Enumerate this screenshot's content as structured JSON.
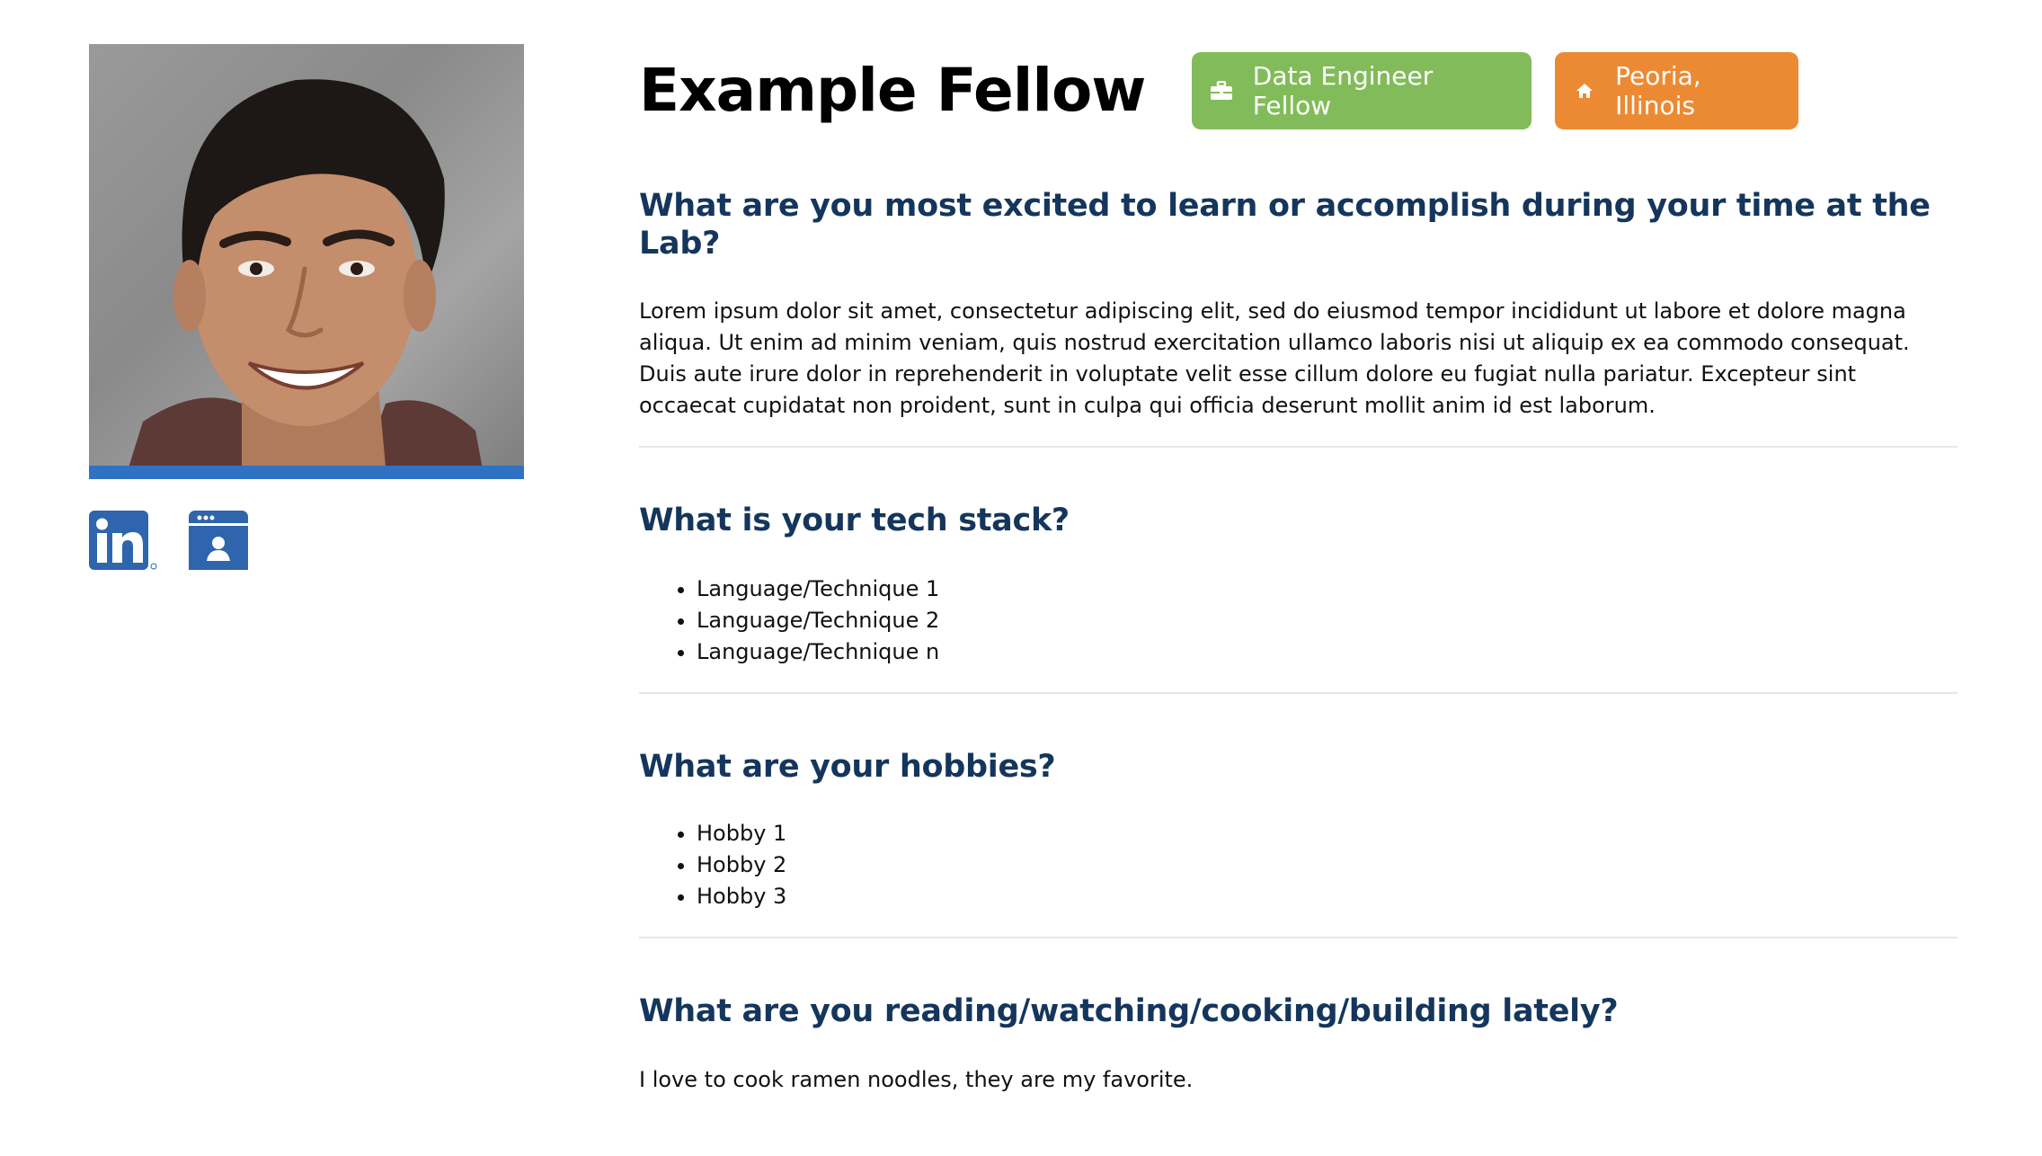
{
  "profile": {
    "name": "Example Fellow",
    "role": "Data Engineer Fellow",
    "location": "Peoria, Illinois",
    "role_icon": "briefcase-icon",
    "location_icon": "home-icon",
    "role_color": "#82bc5a",
    "location_color": "#ec8a33"
  },
  "social": {
    "linkedin_icon": "linkedin-icon",
    "portfolio_icon": "portfolio-icon",
    "icon_color": "#2f65ad"
  },
  "sections": {
    "excited": {
      "heading": "What are you most excited to learn or accomplish during your time at the Lab?",
      "body": "Lorem ipsum dolor sit amet, consectetur adipiscing elit, sed do eiusmod tempor incididunt ut labore et dolore magna aliqua. Ut enim ad minim veniam, quis nostrud exercitation ullamco laboris nisi ut aliquip ex ea commodo consequat. Duis aute irure dolor in reprehenderit in voluptate velit esse cillum dolore eu fugiat nulla pariatur. Excepteur sint occaecat cupidatat non proident, sunt in culpa qui officia deserunt mollit anim id est laborum."
    },
    "tech_stack": {
      "heading": "What is your tech stack?",
      "items": [
        "Language/Technique 1",
        "Language/Technique 2",
        "Language/Technique n"
      ]
    },
    "hobbies": {
      "heading": "What are your hobbies?",
      "items": [
        "Hobby 1",
        "Hobby 2",
        "Hobby 3"
      ]
    },
    "lately": {
      "heading": "What are you reading/watching/cooking/building lately?",
      "body": "I love to cook ramen noodles, they are my favorite."
    }
  },
  "colors": {
    "heading": "#15365c",
    "photo_bar": "#2f72c4"
  }
}
